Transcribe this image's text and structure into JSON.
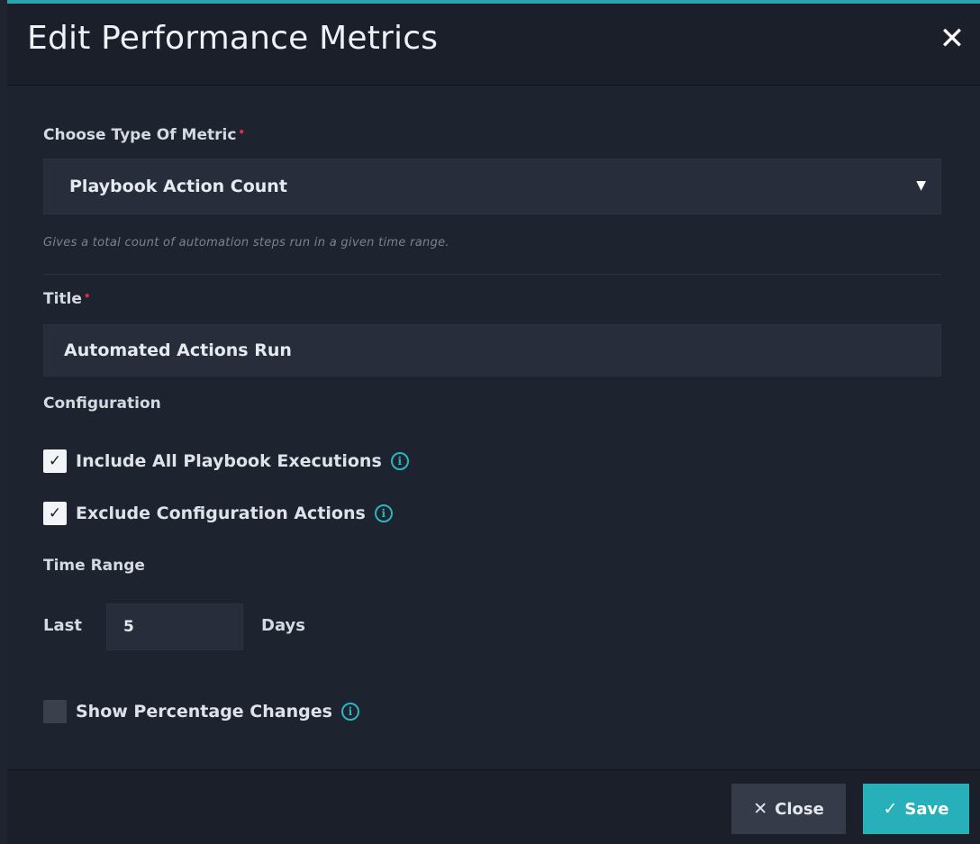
{
  "dialog": {
    "title": "Edit Performance Metrics",
    "close_icon": "close-icon"
  },
  "metric_type": {
    "label": "Choose Type Of Metric",
    "required_marker": "•",
    "selected": "Playbook Action Count",
    "help": "Gives a total count of automation steps run in a given time range."
  },
  "title_field": {
    "label": "Title",
    "required_marker": "•",
    "value": "Automated Actions Run"
  },
  "configuration": {
    "heading": "Configuration",
    "options": [
      {
        "label": "Include All Playbook Executions",
        "checked": true
      },
      {
        "label": "Exclude Configuration Actions",
        "checked": true
      }
    ]
  },
  "time_range": {
    "heading": "Time Range",
    "prefix": "Last",
    "value": "5",
    "unit": "Days"
  },
  "percentage": {
    "label": "Show Percentage Changes",
    "checked": false
  },
  "footer": {
    "close_label": "Close",
    "save_label": "Save"
  },
  "colors": {
    "accent": "#27b0ba",
    "required": "#d0334a",
    "background": "#1e2330"
  }
}
